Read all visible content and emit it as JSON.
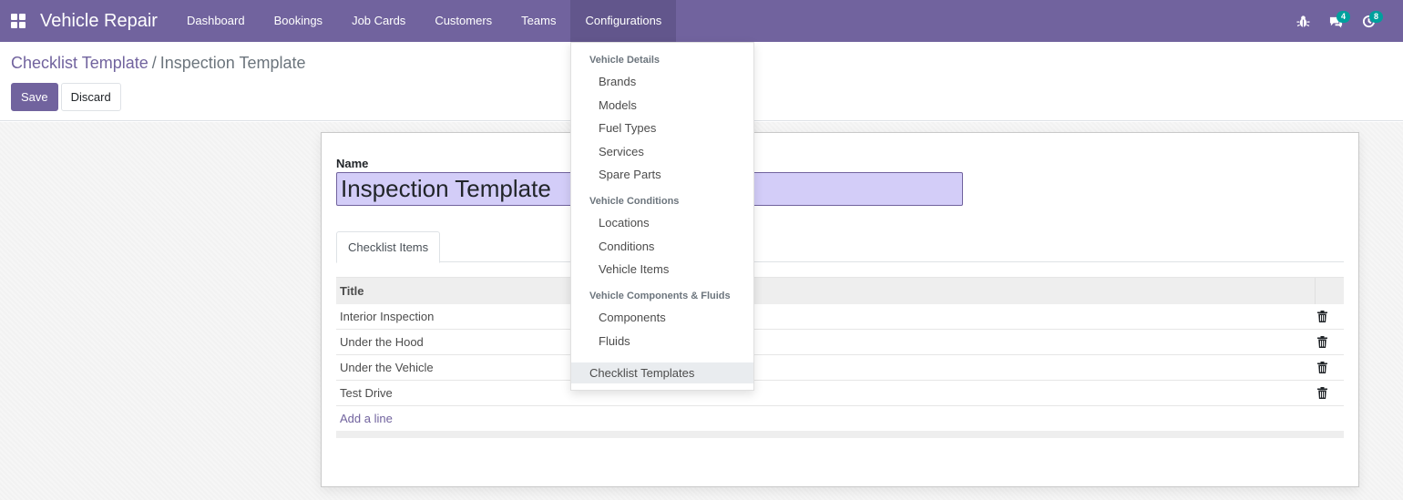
{
  "navbar": {
    "brand": "Vehicle Repair",
    "menu": [
      "Dashboard",
      "Bookings",
      "Job Cards",
      "Customers",
      "Teams",
      "Configurations"
    ],
    "messages_count": "4",
    "activities_count": "8",
    "icons": [
      "apps-grid-icon",
      "bug-icon",
      "chat-icon",
      "clock-icon"
    ],
    "accent_color": "#71639e"
  },
  "control_panel": {
    "breadcrumb_parent": "Checklist Template",
    "breadcrumb_separator": "/",
    "breadcrumb_current": "Inspection Template",
    "save_label": "Save",
    "discard_label": "Discard"
  },
  "form": {
    "name_label": "Name",
    "name_value": "Inspection Template",
    "tab_label": "Checklist Items",
    "column_title": "Title",
    "rows": [
      "Interior Inspection",
      "Under the Hood",
      "Under the Vehicle",
      "Test Drive"
    ],
    "add_line_label": "Add a line"
  },
  "dropdown": {
    "section1": "Vehicle Details",
    "section1_items": [
      "Brands",
      "Models",
      "Fuel Types",
      "Services",
      "Spare Parts"
    ],
    "section2": "Vehicle Conditions",
    "section2_items": [
      "Locations",
      "Conditions",
      "Vehicle Items"
    ],
    "section3": "Vehicle Components & Fluids",
    "section3_items": [
      "Components",
      "Fluids"
    ],
    "standalone_item": "Checklist Templates"
  }
}
